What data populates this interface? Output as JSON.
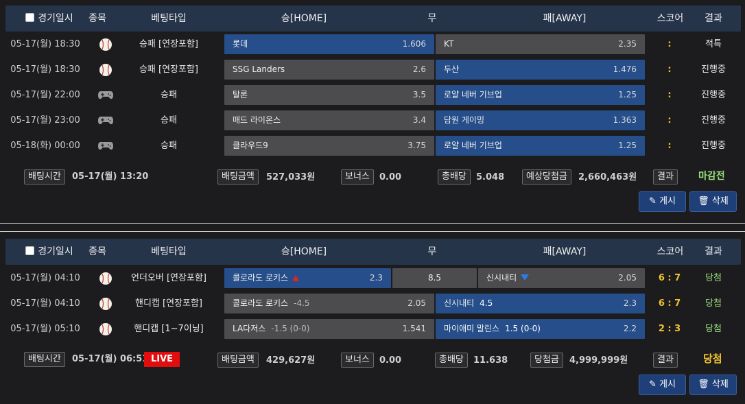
{
  "headers": {
    "date": "경기일시",
    "sport": "종목",
    "bet_type": "베팅타입",
    "home": "승[HOME]",
    "draw": "무",
    "away": "패[AWAY]",
    "score": "스코어",
    "result": "결과"
  },
  "slips": [
    {
      "rows": [
        {
          "date": "05-17(월) 18:30",
          "sport_icon": "baseball-icon",
          "bet_type": "승패 [연장포함]",
          "home": "롯데",
          "home_odds": "1.606",
          "away": "KT",
          "away_odds": "2.35",
          "score": ":",
          "result": "적특"
        },
        {
          "date": "05-17(월) 18:30",
          "sport_icon": "baseball-icon",
          "bet_type": "승패 [연장포함]",
          "home": "SSG Landers",
          "home_odds": "2.6",
          "away": "두산",
          "away_odds": "1.476",
          "score": ":",
          "result": "진행중"
        },
        {
          "date": "05-17(월) 22:00",
          "sport_icon": "gamepad-icon",
          "bet_type": "승패",
          "home": "탈론",
          "home_odds": "3.5",
          "away": "로얄 네버 기브업",
          "away_odds": "1.25",
          "score": ":",
          "result": "진행중"
        },
        {
          "date": "05-17(월) 23:00",
          "sport_icon": "gamepad-icon",
          "bet_type": "승패",
          "home": "매드 라이온스",
          "home_odds": "3.4",
          "away": "담원 게이밍",
          "away_odds": "1.363",
          "score": ":",
          "result": "진행중"
        },
        {
          "date": "05-18(화) 00:00",
          "sport_icon": "gamepad-icon",
          "bet_type": "승패",
          "home": "클라우드9",
          "home_odds": "3.75",
          "away": "로얄 네버 기브업",
          "away_odds": "1.25",
          "score": ":",
          "result": "진행중"
        }
      ],
      "summary": {
        "bet_time_label": "배팅시간",
        "bet_time": "05-17(월) 13:20",
        "amount_label": "배팅금액",
        "amount": "527,033원",
        "bonus_label": "보너스",
        "bonus": "0.00",
        "total_odds_label": "총배당",
        "total_odds": "5.048",
        "payout_label": "예상당첨금",
        "payout": "2,660,463원",
        "result_label": "결과",
        "result": "마감전"
      },
      "buttons": {
        "post": "게시",
        "delete": "삭제"
      }
    },
    {
      "rows": [
        {
          "date": "05-17(월) 04:10",
          "sport_icon": "baseball-icon",
          "bet_type": "언더오버 [연장포함]",
          "home": "콜로라도 로키스",
          "home_odds": "2.3",
          "draw": "8.5",
          "away": "신시내티",
          "away_odds": "2.05",
          "score": "6 : 7",
          "result": "당첨"
        },
        {
          "date": "05-17(월) 04:10",
          "sport_icon": "baseball-icon",
          "bet_type": "핸디캡 [연장포함]",
          "home": "콜로라도 로키스",
          "home_handicap": "-4.5",
          "home_odds": "2.05",
          "away": "신시내티",
          "away_handicap": "4.5",
          "away_odds": "2.3",
          "score": "6 : 7",
          "result": "당첨"
        },
        {
          "date": "05-17(월) 05:10",
          "sport_icon": "baseball-icon",
          "bet_type": "핸디캡 [1~7이닝]",
          "home": "LA다저스",
          "home_handicap": "-1.5 (0-0)",
          "home_odds": "1.541",
          "away": "마이애미 말린스",
          "away_handicap": "1.5 (0-0)",
          "away_odds": "2.2",
          "score": "2 : 3",
          "result": "당첨"
        }
      ],
      "summary": {
        "bet_time_label": "배팅시간",
        "bet_time": "05-17(월) 06:51",
        "live": "LIVE",
        "amount_label": "배팅금액",
        "amount": "429,627원",
        "bonus_label": "보너스",
        "bonus": "0.00",
        "total_odds_label": "총배당",
        "total_odds": "11.638",
        "payout_label": "당첨금",
        "payout": "4,999,999원",
        "result_label": "결과",
        "result": "당첨"
      },
      "buttons": {
        "post": "게시",
        "delete": "삭제"
      }
    }
  ],
  "colors": {
    "header_bg": "#26344a",
    "selected_odds": "#264e8a",
    "unselected_odds": "#4c4c4f",
    "win": "#9be07c",
    "score": "#f2c22e",
    "live": "#e20d0d"
  }
}
